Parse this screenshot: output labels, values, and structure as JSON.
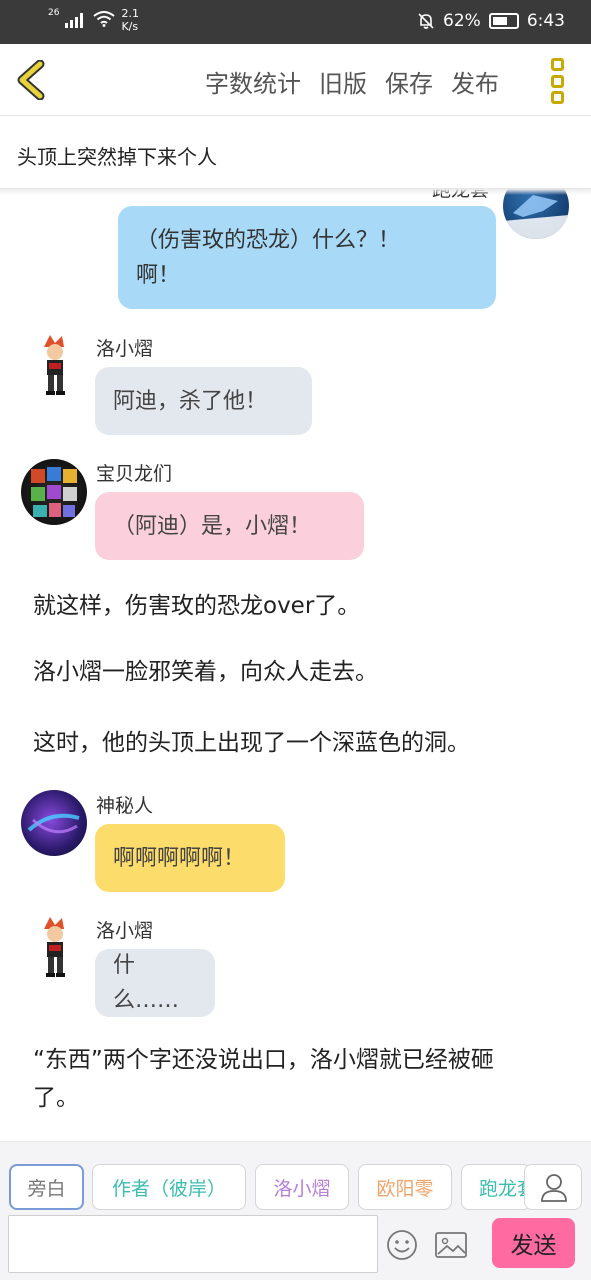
{
  "status_bar": {
    "signal_tag": "26",
    "net_speed_value": "2.1",
    "net_speed_unit": "K/s",
    "battery": "62%",
    "time": "6:43"
  },
  "toolbar": {
    "word_count": "字数统计",
    "old_version": "旧版",
    "save": "保存",
    "publish": "发布"
  },
  "chapter": {
    "title": "头顶上突然掉下来个人"
  },
  "messages": [
    {
      "speaker": "跑龙套",
      "text": "（伤害玫的恐龙）什么？！啊！",
      "color": "#a8daf8"
    },
    {
      "speaker": "洛小熠",
      "text": "阿迪，杀了他！",
      "color": "#e3e7ee"
    },
    {
      "speaker": "宝贝龙们",
      "text": "（阿迪）是，小熠！",
      "color": "#fbd0dc"
    },
    {
      "narration": "就这样，伤害玫的恐龙over了。"
    },
    {
      "narration": "洛小熠一脸邪笑着，向众人走去。"
    },
    {
      "narration": "这时，他的头顶上出现了一个深蓝色的洞。"
    },
    {
      "speaker": "神秘人",
      "text": "啊啊啊啊啊！",
      "color": "#fcdc6a"
    },
    {
      "speaker": "洛小熠",
      "text": "什么……",
      "color": "#e3e7ee"
    },
    {
      "narration": "“东西”两个字还没说出口，洛小熠就已经被砸了。"
    }
  ],
  "bubble_lines": {
    "first_line1": "（伤害玫的恐龙）什么？！",
    "first_line2": "啊！"
  },
  "narration_lines": {
    "last_line1": "“东西”两个字还没说出口，洛小熠就已经被砸",
    "last_line2": "了。"
  },
  "roles": [
    {
      "label": "旁白",
      "color": "#777777"
    },
    {
      "label": "作者（彼岸）",
      "color": "#3dbdb0"
    },
    {
      "label": "洛小熠",
      "color": "#b77fd6"
    },
    {
      "label": "欧阳零",
      "color": "#f0a46a"
    },
    {
      "label": "跑龙套",
      "color": "#3dbdb0"
    }
  ],
  "composer": {
    "input_placeholder": "",
    "send_label": "发送"
  },
  "colors": {
    "accent_send": "#ff6aa0",
    "back_arrow": "#c9a900"
  },
  "icons": [
    "back-arrow-icon",
    "more-menu-icon",
    "emoji-icon",
    "image-icon",
    "user-icon",
    "bell-off-icon",
    "wifi-icon",
    "signal-icon",
    "battery-icon"
  ]
}
